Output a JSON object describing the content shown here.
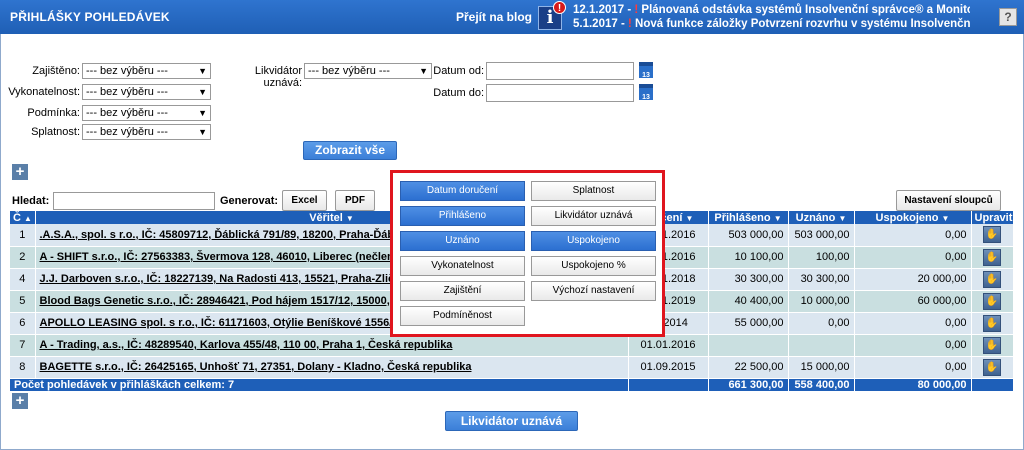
{
  "header": {
    "title": "PŘIHLÁŠKY POHLEDÁVEK",
    "blog_link": "Přejít na blog",
    "info_icon": "info-icon",
    "alert_mark": "!",
    "news": [
      {
        "date": "12.1.2017 - ",
        "bang": "! ",
        "text": "Plánovaná odstávka systémů Insolvenční správce® a Monitorir"
      },
      {
        "date": "5.1.2017 - ",
        "bang": "! ",
        "text": "Nová funkce záložky Potvrzení rozvrhu v systému Insolvenční sp"
      }
    ],
    "help": "?"
  },
  "filters": {
    "zajisteno_label": "Zajištěno:",
    "zajisteno_value": "--- bez výběru ---",
    "vykonatelnost_label": "Vykonatelnost:",
    "vykonatelnost_value": "--- bez výběru ---",
    "podminka_label": "Podmínka:",
    "podminka_value": "--- bez výběru ---",
    "splatnost_label": "Splatnost:",
    "splatnost_value": "--- bez výběru ---",
    "likvidator_label": "Likvidátor uznává:",
    "likvidator_value": "--- bez výběru ---",
    "datum_od_label": "Datum od:",
    "datum_do_label": "Datum do:",
    "calendar_text": "13",
    "show_all_button": "Zobrazit vše"
  },
  "toolbar": {
    "search_label": "Hledat:",
    "generate_label": "Generovat:",
    "excel_button": "Excel",
    "pdf_button": "PDF",
    "column_settings_button": "Nastavení sloupců"
  },
  "table": {
    "headers": {
      "c": "Č",
      "veritel": "Věřitel",
      "doruceni": "oručení",
      "prihlaseno": "Přihlášeno",
      "uznano": "Uznáno",
      "uspokojeno": "Uspokojeno",
      "upravit": "Upravit"
    },
    "rows": [
      {
        "c": "1",
        "veritel": ".A.S.A., spol. s r.o., IČ: 45809712, Ďáblická 791/89, 18200, Praha-Ďáblice, Česká republika",
        "doruceni": "01.01.2016",
        "prihlaseno": "503 000,00",
        "uznano": "503 000,00",
        "uspokojeno": "0,00"
      },
      {
        "c": "2",
        "veritel": "A - SHIFT s.r.o., IČ: 27563383, Švermova 128, 46010, Liberec (nečleněné město), Česká republika",
        "doruceni": "01.01.2016",
        "prihlaseno": "10 100,00",
        "uznano": "100,00",
        "uspokojeno": "0,00"
      },
      {
        "c": "4",
        "veritel": "J.J. Darboven s.r.o., IČ: 18227139, Na Radosti 413, 15521, Praha-Zličín, Česká republika",
        "doruceni": "01.01.2018",
        "prihlaseno": "30 300,00",
        "uznano": "30 300,00",
        "uspokojeno": "20 000,00"
      },
      {
        "c": "5",
        "veritel": "Blood Bags Genetic s.r.o., IČ: 28946421, Pod hájem 1517/12, 15000, Praha 5, Česká republika",
        "doruceni": "01.01.2019",
        "prihlaseno": "40 400,00",
        "uznano": "10 000,00",
        "uspokojeno": "60 000,00"
      },
      {
        "c": "6",
        "veritel": "APOLLO LEASING spol. s r.o., IČ: 61171603, Otýlie Beníškové 1556/12, 30100, Plzeň, Česká republika",
        "doruceni": "03.2014",
        "prihlaseno": "55 000,00",
        "uznano": "0,00",
        "uspokojeno": "0,00"
      },
      {
        "c": "7",
        "veritel": "A - Trading, a.s., IČ: 48289540, Karlova 455/48, 110 00, Praha 1, Česká republika",
        "doruceni": "01.01.2016",
        "prihlaseno": "",
        "uznano": "",
        "uspokojeno": "0,00"
      },
      {
        "c": "8",
        "veritel": "BAGETTE s.r.o., IČ: 26425165, Unhošť 71, 27351, Dolany - Kladno, Česká republika",
        "doruceni": "01.09.2015",
        "prihlaseno": "22 500,00",
        "uznano": "15 000,00",
        "uspokojeno": "0,00"
      }
    ],
    "footer": {
      "label": "Počet pohledávek v přihláškách celkem: 7",
      "prihlaseno": "661 300,00",
      "uznano": "558 400,00",
      "uspokojeno": "80 000,00"
    }
  },
  "bottom_button": "Likvidátor uznává",
  "column_popup": {
    "left": [
      {
        "label": "Datum doručení",
        "active": true
      },
      {
        "label": "Přihlášeno",
        "active": true
      },
      {
        "label": "Uznáno",
        "active": true
      },
      {
        "label": "Vykonatelnost",
        "active": false
      },
      {
        "label": "Zajištění",
        "active": false
      },
      {
        "label": "Podmíněnost",
        "active": false
      }
    ],
    "right": [
      {
        "label": "Splatnost",
        "active": false
      },
      {
        "label": "Likvidátor uznává",
        "active": false
      },
      {
        "label": "Uspokojeno",
        "active": true
      },
      {
        "label": "Uspokojeno %",
        "active": false
      },
      {
        "label": "Výchozí nastavení",
        "active": false
      }
    ]
  },
  "colors": {
    "header_blue": "#1e5fb8",
    "highlight_red": "#e0161e"
  }
}
